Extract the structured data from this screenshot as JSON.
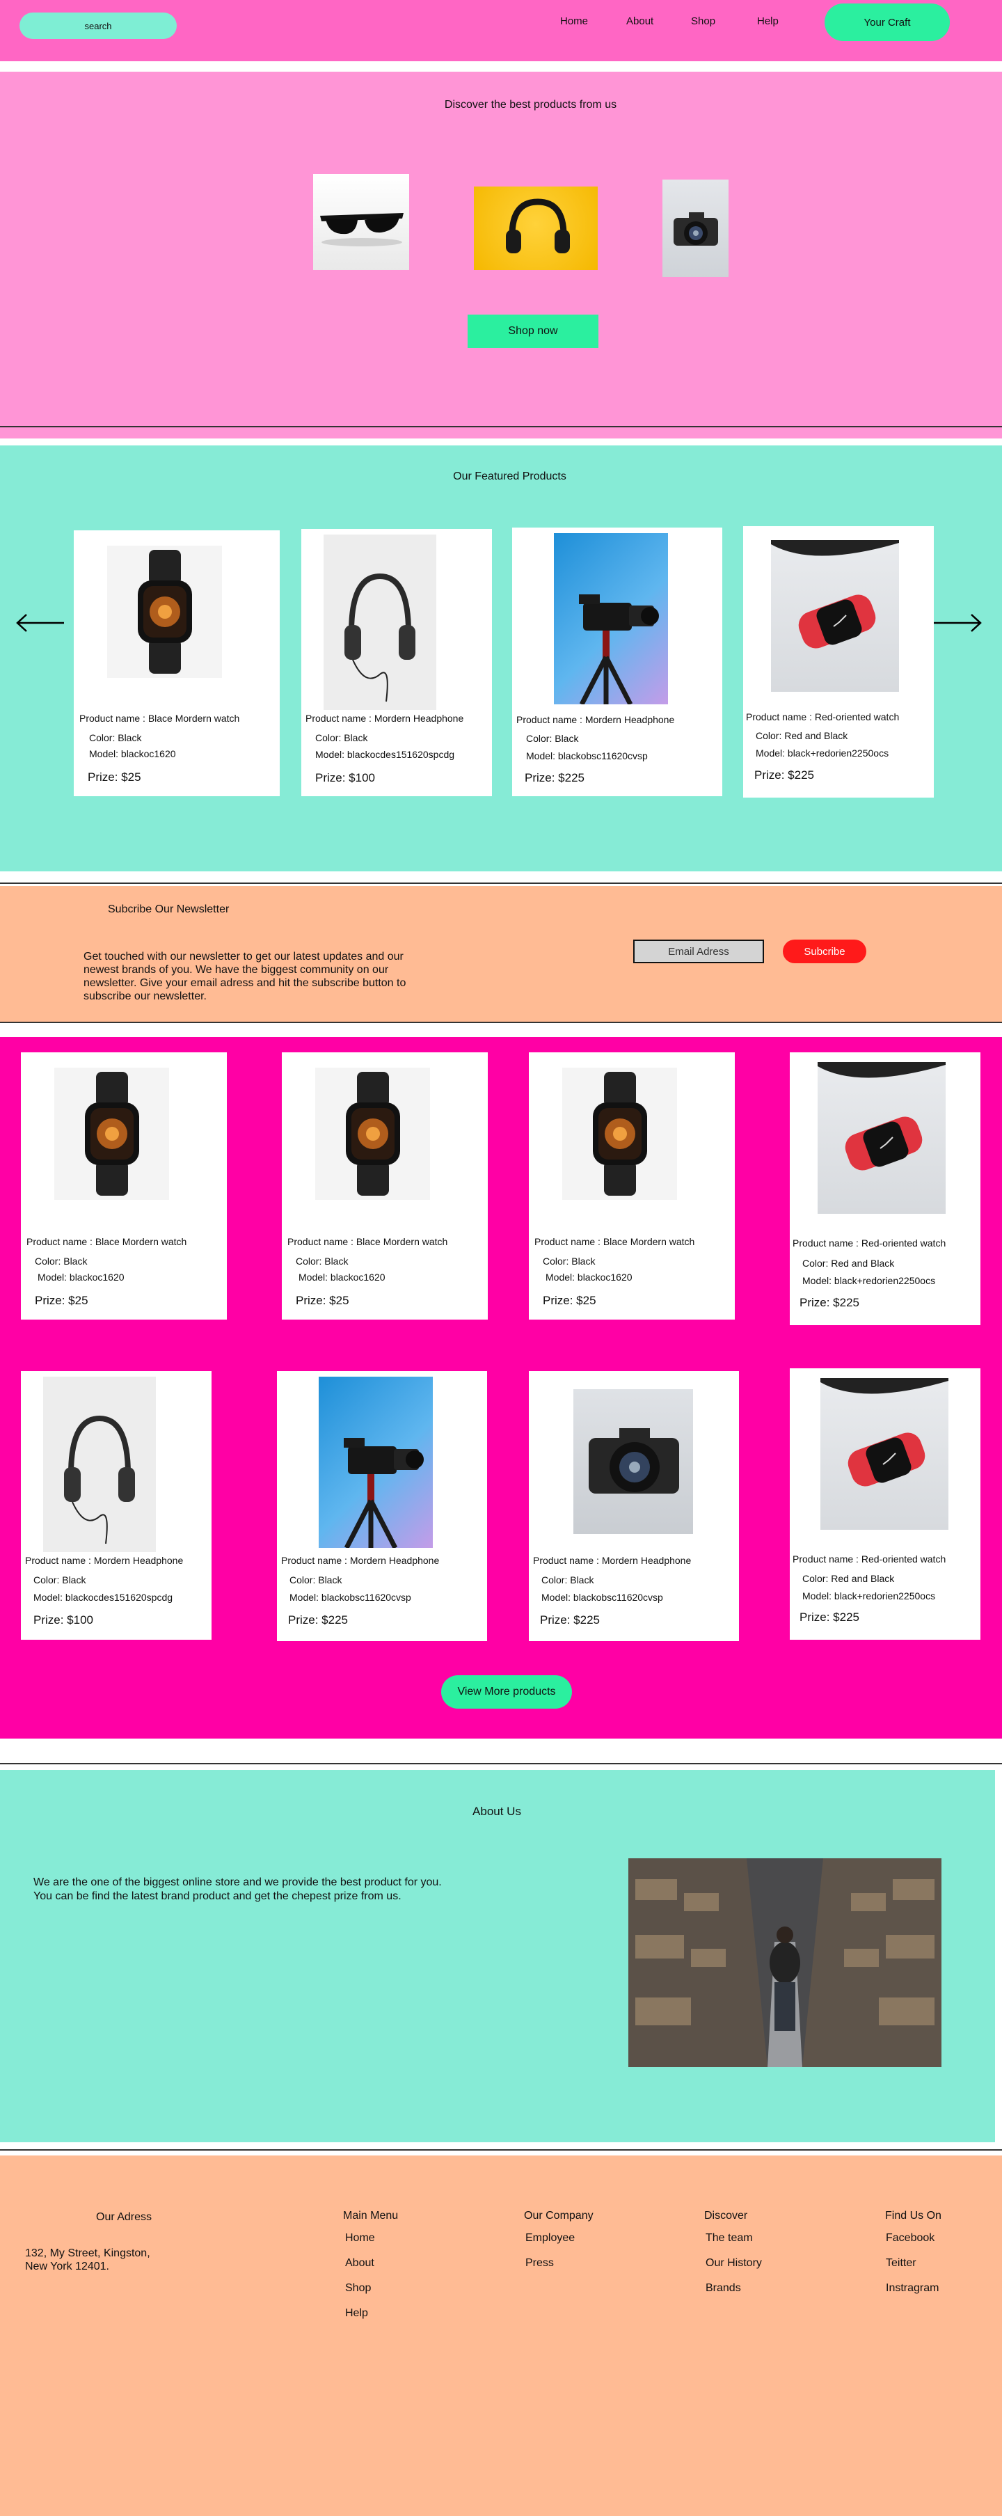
{
  "header": {
    "search_placeholder": "search",
    "nav": [
      "Home",
      "About",
      "Shop",
      "Help"
    ],
    "cart_label": "Your Craft"
  },
  "hero": {
    "title": "Discover the best products from us",
    "cta": "Shop now"
  },
  "featured": {
    "title": "Our Featured Products",
    "cards": [
      {
        "name": "Product name : Blace Mordern watch",
        "color": "Color: Black",
        "model": "Model: blackoc1620",
        "price": "Prize: $25"
      },
      {
        "name": "Product name :  Mordern  Headphone",
        "color": "Color: Black",
        "model": "Model: blackocdes151620spcdg",
        "price": "Prize: $100"
      },
      {
        "name": "Product name :  Mordern  Headphone",
        "color": "Color: Black",
        "model": "Model: blackobsc11620cvsp",
        "price": "Prize: $225"
      },
      {
        "name": "Product name :  Red-oriented watch",
        "color": "Color: Red and Black",
        "model": "Model: black+redorien2250ocs",
        "price": "Prize: $225"
      }
    ]
  },
  "newsletter": {
    "title": "Subcribe Our Newsletter",
    "text": "Get touched with our newsletter to get our latest updates and our newest brands of you. We have the biggest community on our newsletter. Give your email adress and hit the subscribe button to subscribe our newsletter.",
    "email_placeholder": "Email Adress",
    "button": "Subcribe"
  },
  "products": {
    "cards": [
      {
        "name": "Product name : Blace Mordern watch",
        "color": "Color: Black",
        "model": "Model: blackoc1620",
        "price": "Prize: $25"
      },
      {
        "name": "Product name : Blace Mordern watch",
        "color": "Color: Black",
        "model": "Model: blackoc1620",
        "price": "Prize: $25"
      },
      {
        "name": "Product name : Blace Mordern watch",
        "color": "Color: Black",
        "model": "Model: blackoc1620",
        "price": "Prize: $25"
      },
      {
        "name": "Product name :  Red-oriented watch",
        "color": "Color: Red and Black",
        "model": "Model: black+redorien2250ocs",
        "price": "Prize: $225"
      },
      {
        "name": "Product name :  Mordern  Headphone",
        "color": "Color: Black",
        "model": "Model: blackocdes151620spcdg",
        "price": "Prize: $100"
      },
      {
        "name": "Product name :  Mordern  Headphone",
        "color": "Color: Black",
        "model": "Model: blackobsc11620cvsp",
        "price": "Prize: $225"
      },
      {
        "name": "Product name :  Mordern  Headphone",
        "color": "Color: Black",
        "model": "Model: blackobsc11620cvsp",
        "price": "Prize: $225"
      },
      {
        "name": "Product name :  Red-oriented watch",
        "color": "Color: Red and Black",
        "model": "Model: black+redorien2250ocs",
        "price": "Prize: $225"
      }
    ],
    "view_more": "View More products"
  },
  "about": {
    "title": "About Us",
    "text": "We are the one of the biggest online store and we provide the best product for you.\n You can be find the latest brand product and get the chepest prize from us."
  },
  "footer": {
    "address_title": "Our Adress",
    "address": "132, My Street, Kingston,\nNew York 12401.",
    "columns": [
      {
        "title": "Main Menu",
        "links": [
          "Home",
          "About",
          "Shop",
          "Help"
        ]
      },
      {
        "title": "Our Company",
        "links": [
          "Employee",
          "Press"
        ]
      },
      {
        "title": "Discover",
        "links": [
          "The team",
          "Our History",
          "Brands"
        ]
      },
      {
        "title": "Find Us On",
        "links": [
          "Facebook",
          "Teitter",
          "Instragram"
        ]
      }
    ]
  },
  "colors": {
    "header_bg": "#ff66c4",
    "hero_bg": "#ff95d6",
    "mint": "#86ebd6",
    "green_button": "#2bef9f",
    "peach": "#ffbb94",
    "magenta": "#ff00a5",
    "subscribe_red": "#ff1a1a"
  },
  "icons": [
    "arrow-left-icon",
    "arrow-right-icon"
  ]
}
